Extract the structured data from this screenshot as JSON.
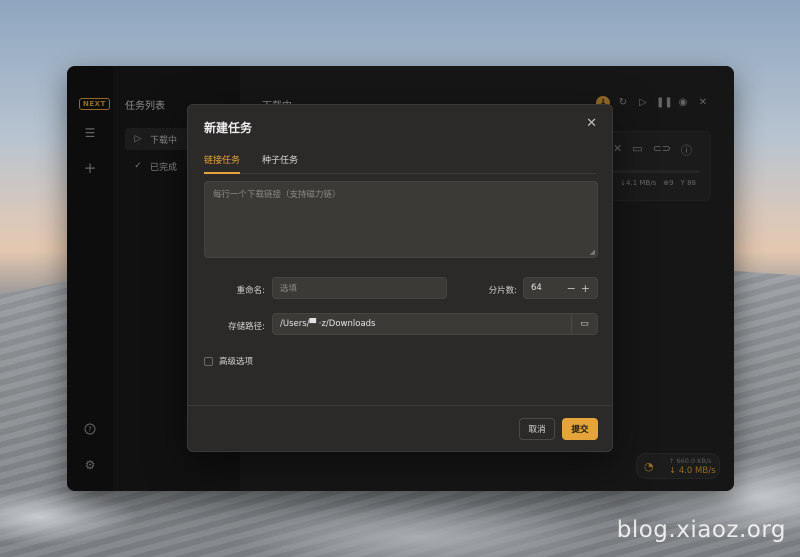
{
  "app": {
    "logo_text": "NEXT",
    "accent": "#e4a43a"
  },
  "sidebar": {
    "list_title": "任务列表",
    "items": [
      {
        "label": "下载中",
        "icon": "play-icon",
        "active": true
      },
      {
        "label": "已完成",
        "icon": "check-icon",
        "active": false
      }
    ],
    "rail_icons": [
      "list-icon",
      "add-icon",
      "help-icon",
      "settings-icon"
    ]
  },
  "main": {
    "title": "下载中",
    "toolbar_icons": [
      "download-badge-icon",
      "refresh-icon",
      "play-icon",
      "pause-icon",
      "stop-icon",
      "close-icon"
    ],
    "task": {
      "stats_speed": "↓4.1 MB/s",
      "stats_prefix": "/s",
      "seeds": "⊕9",
      "peers": "Y 88"
    },
    "speed": {
      "upload": "↑ 660.0 KB/s",
      "download": "↓ 4.0 MB/s"
    }
  },
  "dialog": {
    "title": "新建任务",
    "tabs": [
      {
        "label": "链接任务",
        "active": true
      },
      {
        "label": "种子任务",
        "active": false
      }
    ],
    "textarea_placeholder": "每行一个下载链接（支持磁力链）",
    "rename_label": "重命名:",
    "rename_placeholder": "选填",
    "split_label": "分片数:",
    "split_value": "64",
    "path_label": "存储路径:",
    "path_value": "/Users/▀  ·z/Downloads",
    "advanced_label": "高级选项",
    "cancel_label": "取消",
    "submit_label": "提交"
  },
  "watermark": "blog.xiaoz.org"
}
